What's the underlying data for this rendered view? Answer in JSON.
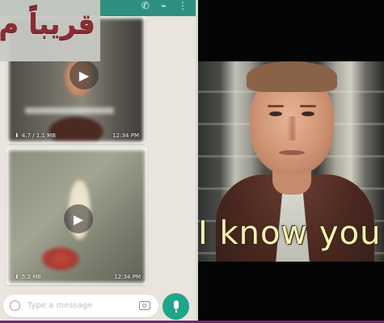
{
  "overlay": {
    "text": "قريباً م"
  },
  "header": {
    "icons": [
      "phone-icon",
      "attach-icon",
      "more-icon"
    ],
    "phone_glyph": "✆",
    "attach_glyph": "⌁",
    "more_glyph": "⋮"
  },
  "messages": [
    {
      "type": "video",
      "size": "4.7 / 1.1 MB",
      "time": "12:34 PM"
    },
    {
      "type": "video",
      "size": "5.2 MB",
      "time": "12:34 PM"
    }
  ],
  "composer": {
    "placeholder": "Type a message"
  },
  "video": {
    "subtitle": "I know you."
  },
  "colors": {
    "header": "#2f8f7f",
    "mic_button": "#1fa58b",
    "chat_bg": "#e9e4dd",
    "subtitle": "#f4f0b8",
    "overlay_text": "#8a2c33"
  }
}
